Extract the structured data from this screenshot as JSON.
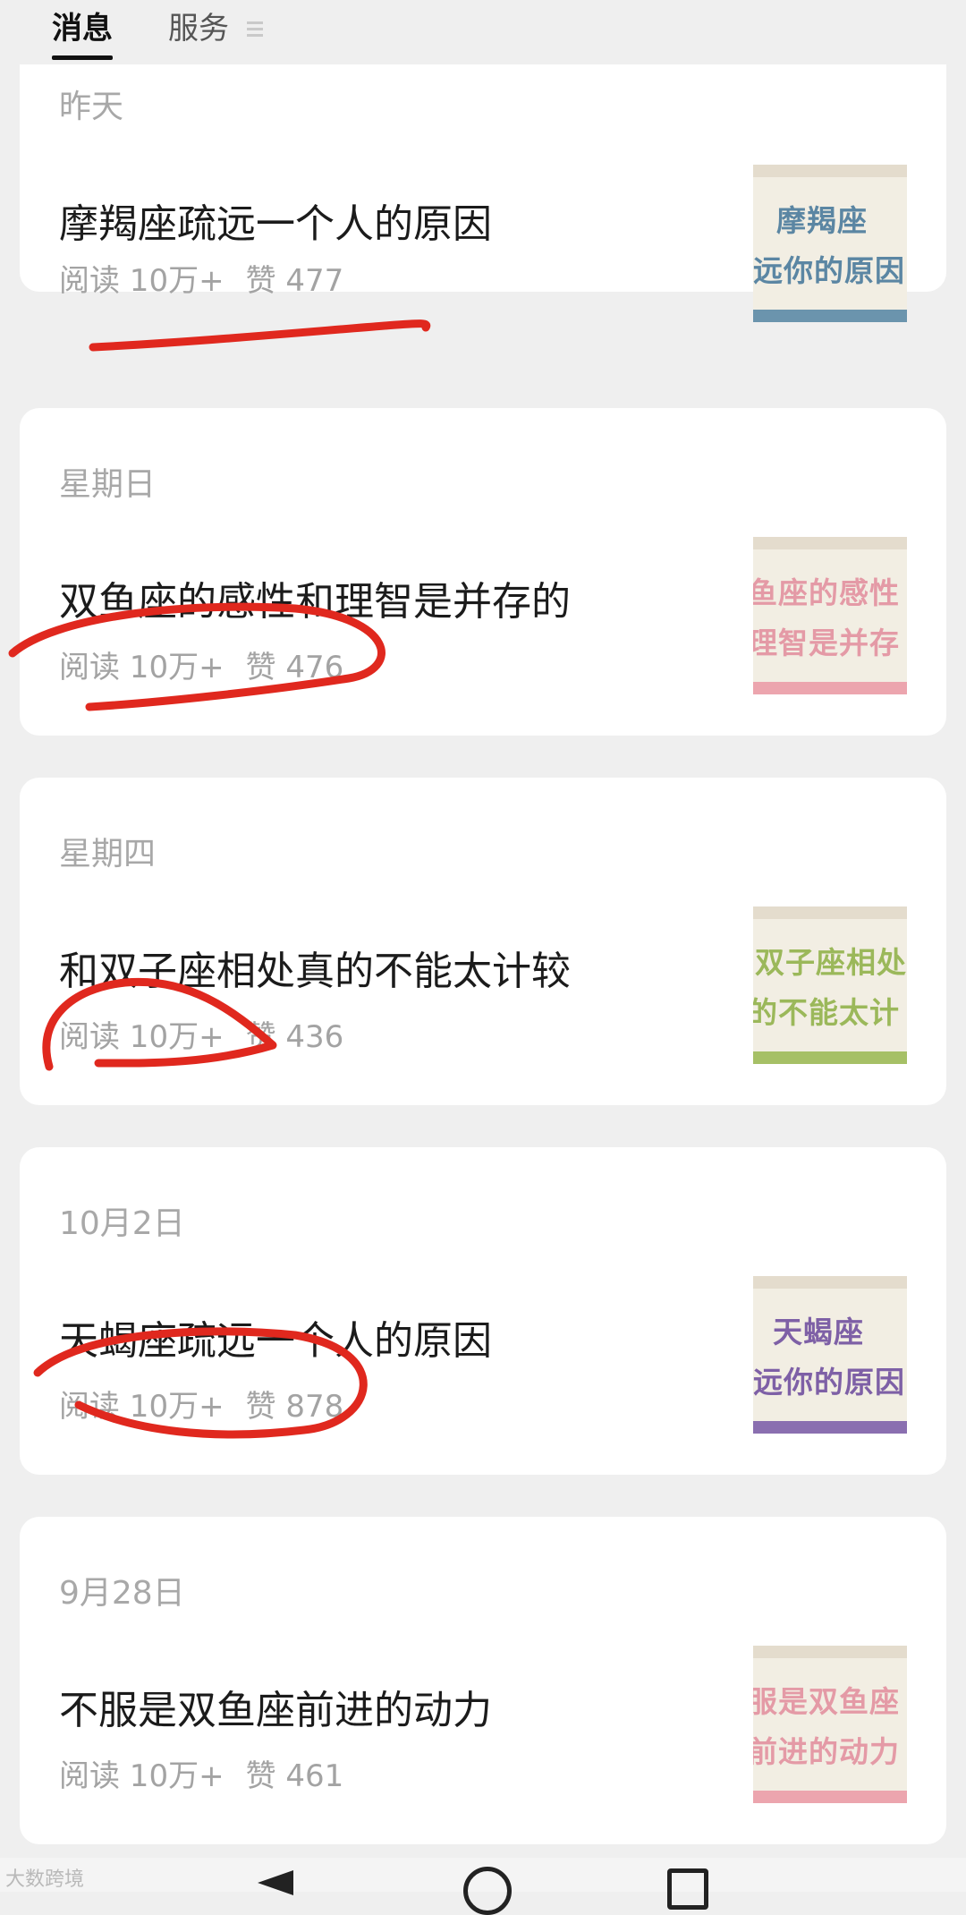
{
  "tabs": [
    {
      "label": "消息",
      "active": true
    },
    {
      "label": "服务",
      "active": false
    }
  ],
  "cards": [
    {
      "date": "昨天",
      "title": "摩羯座疏远一个人的原因",
      "reads": "阅读 10万+",
      "likes": "赞 477",
      "thumb": {
        "line1": "摩羯座",
        "line2": "远你的原因",
        "color": "#5b86a3",
        "stripe": "#6b94ad"
      }
    },
    {
      "date": "星期日",
      "title": "双鱼座的感性和理智是并存的",
      "reads": "阅读 10万+",
      "likes": "赞 476",
      "thumb": {
        "line1": "鱼座的感性",
        "line2": "理智是并存",
        "color": "#e49aa6",
        "stripe": "#eca5ae"
      }
    },
    {
      "date": "星期四",
      "title": "和双子座相处真的不能太计较",
      "reads": "阅读 10万+",
      "likes": "赞 436",
      "thumb": {
        "line1": "双子座相处",
        "line2": "的不能太计",
        "color": "#9bb85a",
        "stripe": "#a6c066"
      }
    },
    {
      "date": "10月2日",
      "title": "天蝎座疏远一个人的原因",
      "reads": "阅读 10万+",
      "likes": "赞 878",
      "thumb": {
        "line1": "天蝎座",
        "line2": "远你的原因",
        "color": "#7e60a6",
        "stripe": "#8a6fb0"
      }
    },
    {
      "date": "9月28日",
      "title": "不服是双鱼座前进的动力",
      "reads": "阅读 10万+",
      "likes": "赞 461",
      "thumb": {
        "line1": "服是双鱼座",
        "line2": "前进的动力",
        "color": "#e49aa6",
        "stripe": "#eca5ae"
      }
    }
  ],
  "watermark": "大数跨境",
  "annotation_color": "#e0281e"
}
